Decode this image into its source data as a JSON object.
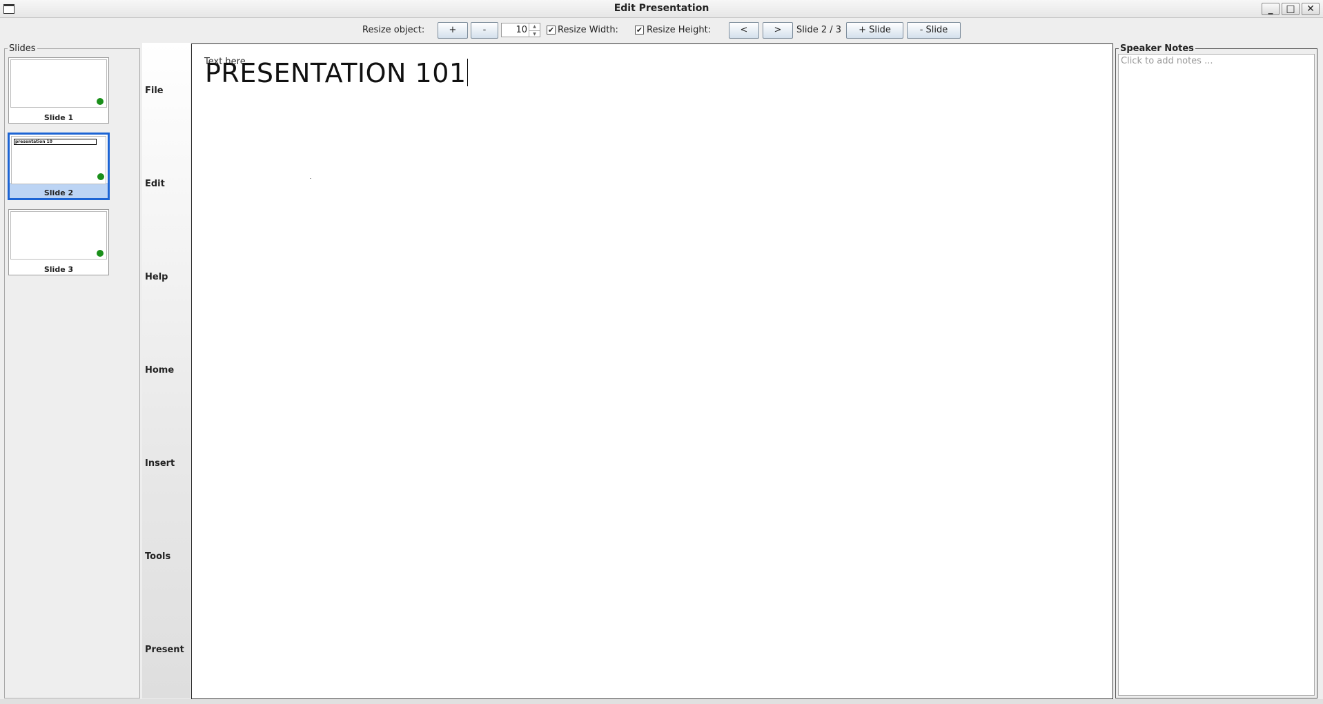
{
  "window": {
    "title": "Edit Presentation",
    "minimize_label": "_",
    "maximize_label": "□",
    "close_label": "✕"
  },
  "toolbar": {
    "resize_label": "Resize object:",
    "plus_label": "+",
    "minus_label": "-",
    "resize_value": "10",
    "resize_width_label": "Resize Width:",
    "resize_width_checked": true,
    "resize_height_label": "Resize Height:",
    "resize_height_checked": true,
    "prev_label": "<",
    "next_label": ">",
    "slide_counter": "Slide 2 / 3",
    "add_slide_label": "+ Slide",
    "remove_slide_label": "- Slide"
  },
  "slides_panel": {
    "title": "Slides",
    "thumbnails": [
      {
        "caption": "Slide 1",
        "selected": false,
        "preview_text": ""
      },
      {
        "caption": "Slide 2",
        "selected": true,
        "preview_text": "presentation 10"
      },
      {
        "caption": "Slide 3",
        "selected": false,
        "preview_text": ""
      }
    ],
    "indicator_color": "#1a8f1a",
    "selection_color": "#1c64d4"
  },
  "menu": {
    "items": [
      "File",
      "Edit",
      "Help",
      "Home",
      "Insert",
      "Tools",
      "Present"
    ]
  },
  "canvas": {
    "placeholder_text": "Text here...",
    "main_text": "PRESENTATION 101"
  },
  "notes": {
    "title": "Speaker Notes",
    "placeholder": "Click to add notes ..."
  }
}
